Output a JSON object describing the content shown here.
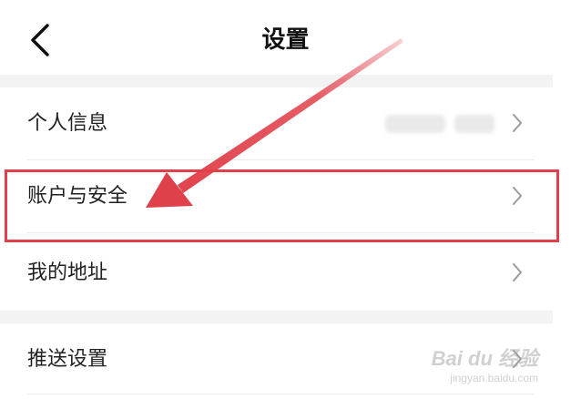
{
  "header": {
    "title": "设置"
  },
  "settings": {
    "items": [
      {
        "label": "个人信息"
      },
      {
        "label": "账户与安全"
      },
      {
        "label": "我的地址"
      },
      {
        "label": "推送设置"
      }
    ]
  },
  "annotation": {
    "color": "#e0404a"
  },
  "watermark": {
    "brand": "Bai du 经验",
    "url": "jingyan.baidu.com"
  }
}
